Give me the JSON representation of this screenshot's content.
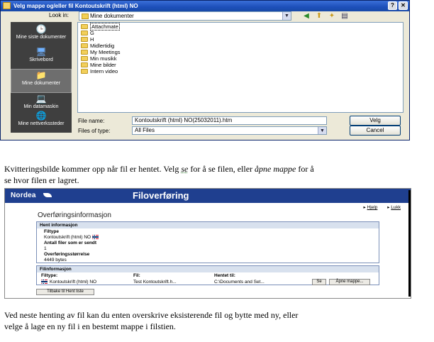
{
  "dialog": {
    "title": "Velg mappe og/eller fil Kontoutskrift (html) NO",
    "look_in_label": "Look in:",
    "look_in_value": "Mine dokumenter",
    "places": [
      {
        "label": "Mine siste dokumenter",
        "icon": "recent-documents-icon"
      },
      {
        "label": "Skrivebord",
        "icon": "desktop-icon"
      },
      {
        "label": "Mine dokumenter",
        "icon": "my-documents-icon"
      },
      {
        "label": "Min datamaskin",
        "icon": "my-computer-icon"
      },
      {
        "label": "Mine nettverkssteder",
        "icon": "network-places-icon"
      }
    ],
    "files": [
      "Attachmate",
      "G",
      "H",
      "Midlertidig",
      "My Meetings",
      "Min musikk",
      "Mine bilder",
      "Intern video"
    ],
    "file_name_label": "File name:",
    "file_name_value": "Kontoutskrift (html) NO(25032011).htm",
    "file_type_label": "Files of type:",
    "file_type_value": "All Files",
    "ok_label": "Velg",
    "cancel_label": "Cancel"
  },
  "text": {
    "para1_line1_a": "Kvitteringsbilde kommer opp når fil er hentet. Velg ",
    "para1_line1_se": "se",
    "para1_line1_b": " for å se filen, eller ",
    "para1_line1_apne": "åpne mappe",
    "para1_line1_c": " for å",
    "para1_line2": "se hvor filen er lagret.",
    "para2_line1": "Ved neste henting av fil kan du enten overskrive eksisterende fil og bytte med ny, eller",
    "para2_line2": "velge å lage en ny fil i en bestemt mappe i filstien."
  },
  "receipt": {
    "brand": "Nordea",
    "title": "Filoverføring",
    "help_link": "Hjelp",
    "close_link": "Lukk",
    "section_title": "Overføringsinformasjon",
    "hent_header": "Hent informasjon",
    "filtype_label": "Filtype",
    "filtype_value": "Kontoutskrift (html) NO",
    "antall_label": "Antall filer som er sendt",
    "antall_value": "1",
    "storrelse_label": "Overføringsstørrelse",
    "storrelse_value": "4449 bytes",
    "fil_header": "Filinformasjon",
    "col_filtype": "Filtype:",
    "col_fil": "Fil:",
    "col_hentet": "Hentet til:",
    "row_filtype": "Kontoutskrift (html) NO",
    "row_fil": "Test Kontoutskrift.h...",
    "row_hentet": "C:\\Documents and Set...",
    "se_button": "Se",
    "apne_button": "Åpne mappe...",
    "back_button": "Tilbake til Hent liste"
  },
  "colors": {
    "nordea_blue": "#1f3f8f",
    "titlebar_blue": "#1d4fb9",
    "places_dark": "#3f3f3f"
  }
}
